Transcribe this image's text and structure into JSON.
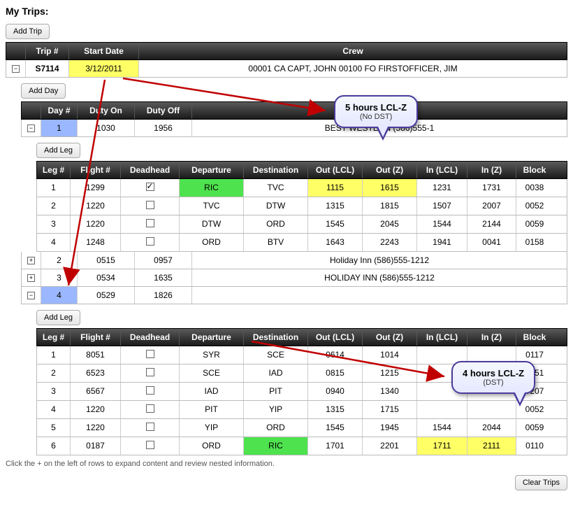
{
  "page_title": "My Trips:",
  "buttons": {
    "add_trip": "Add Trip",
    "add_day": "Add Day",
    "add_leg": "Add Leg",
    "clear_trips": "Clear Trips"
  },
  "trip_headers": {
    "trip": "Trip #",
    "start": "Start Date",
    "crew": "Crew"
  },
  "trip": {
    "trip_no": "S7114",
    "start_date": "3/12/2011",
    "crew": "00001 CA CAPT, JOHN 00100 FO FIRSTOFFICER, JIM"
  },
  "day_headers": {
    "day": "Day #",
    "on": "Duty On",
    "off": "Duty Off"
  },
  "days_collapsed": [
    {
      "n": "2",
      "on": "0515",
      "off": "0957",
      "hotel": "Holiday Inn (586)555-1212"
    },
    {
      "n": "3",
      "on": "0534",
      "off": "1635",
      "hotel": "HOLIDAY INN (586)555-1212"
    }
  ],
  "day1": {
    "n": "1",
    "on": "1030",
    "off": "1956",
    "hotel": "BEST WESTERN (586)555-1"
  },
  "day4": {
    "n": "4",
    "on": "0529",
    "off": "1826",
    "hotel": ""
  },
  "leg_headers": {
    "leg": "Leg #",
    "flight": "Flight #",
    "dead": "Deadhead",
    "dep": "Departure",
    "dest": "Destination",
    "outl": "Out (LCL)",
    "outz": "Out (Z)",
    "inl": "In (LCL)",
    "inz": "In (Z)",
    "block": "Block"
  },
  "legs_day1": [
    {
      "leg": "1",
      "flight": "1299",
      "dead": true,
      "dep": "RIC",
      "dep_hl": "green",
      "dest": "TVC",
      "outl": "1115",
      "outl_hl": "yellow",
      "outz": "1615",
      "outz_hl": "yellow",
      "inl": "1231",
      "inz": "1731",
      "block": "0038"
    },
    {
      "leg": "2",
      "flight": "1220",
      "dead": false,
      "dep": "TVC",
      "dest": "DTW",
      "outl": "1315",
      "outz": "1815",
      "inl": "1507",
      "inz": "2007",
      "block": "0052"
    },
    {
      "leg": "3",
      "flight": "1220",
      "dead": false,
      "dep": "DTW",
      "dest": "ORD",
      "outl": "1545",
      "outz": "2045",
      "inl": "1544",
      "inz": "2144",
      "block": "0059"
    },
    {
      "leg": "4",
      "flight": "1248",
      "dead": false,
      "dep": "ORD",
      "dest": "BTV",
      "outl": "1643",
      "outz": "2243",
      "inl": "1941",
      "inz": "0041",
      "block": "0158"
    }
  ],
  "legs_day4": [
    {
      "leg": "1",
      "flight": "8051",
      "dead": false,
      "dep": "SYR",
      "dest": "SCE",
      "outl": "0614",
      "outz": "1014",
      "inl": "",
      "inz": "",
      "block": "0117"
    },
    {
      "leg": "2",
      "flight": "6523",
      "dead": false,
      "dep": "SCE",
      "dest": "IAD",
      "outl": "0815",
      "outz": "1215",
      "inl": "",
      "inz": "",
      "block": "0051"
    },
    {
      "leg": "3",
      "flight": "6567",
      "dead": false,
      "dep": "IAD",
      "dest": "PIT",
      "outl": "0940",
      "outz": "1340",
      "inl": "",
      "inz": "",
      "block": "0207"
    },
    {
      "leg": "4",
      "flight": "1220",
      "dead": false,
      "dep": "PIT",
      "dest": "YIP",
      "outl": "1315",
      "outz": "1715",
      "inl": "",
      "inz": "",
      "block": "0052"
    },
    {
      "leg": "5",
      "flight": "1220",
      "dead": false,
      "dep": "YIP",
      "dest": "ORD",
      "outl": "1545",
      "outz": "1945",
      "inl": "1544",
      "inz": "2044",
      "block": "0059"
    },
    {
      "leg": "6",
      "flight": "0187",
      "dead": false,
      "dep": "ORD",
      "dest": "RIC",
      "dest_hl": "green",
      "outl": "1701",
      "outz": "2201",
      "inl": "1711",
      "inl_hl": "yellow",
      "inz": "2111",
      "inz_hl": "yellow",
      "block": "0110"
    }
  ],
  "footer": "Click the + on the left of rows to expand content and review nested information.",
  "callouts": {
    "c1": {
      "title": "5 hours LCL-Z",
      "sub": "(No DST)"
    },
    "c2": {
      "title": "4 hours LCL-Z",
      "sub": "(DST)"
    }
  }
}
